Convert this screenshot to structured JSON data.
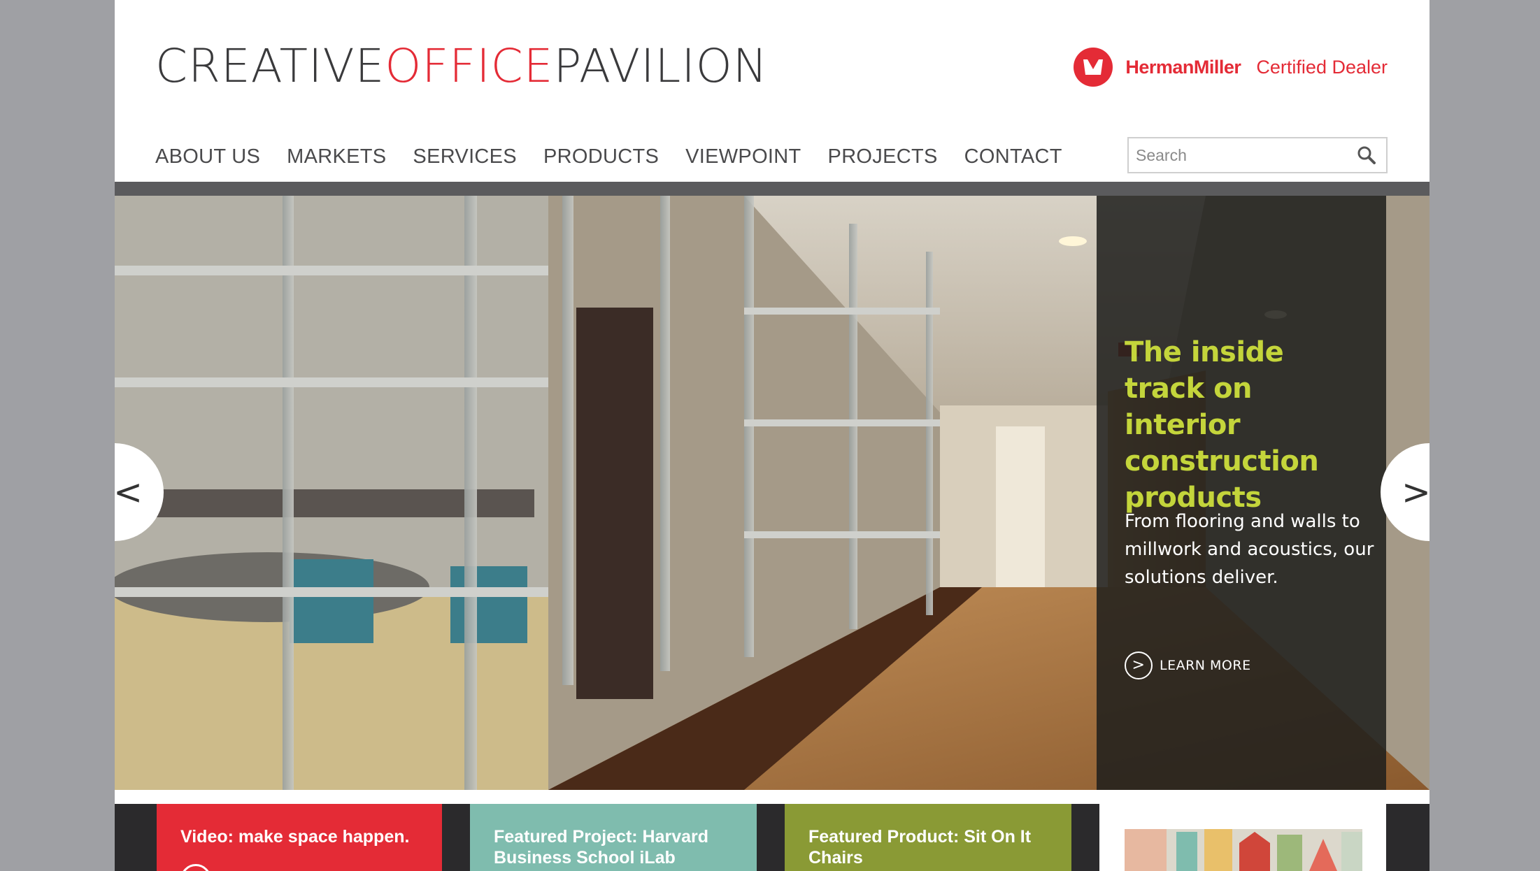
{
  "header": {
    "logo": {
      "part1": "CREATIVE",
      "part2": "OFFICE",
      "part3": "PAVILION"
    },
    "dealer": {
      "brand": "HermanMiller",
      "certified": "Certified Dealer"
    }
  },
  "nav": {
    "items": [
      {
        "label": "ABOUT US"
      },
      {
        "label": "MARKETS"
      },
      {
        "label": "SERVICES"
      },
      {
        "label": "PRODUCTS"
      },
      {
        "label": "VIEWPOINT"
      },
      {
        "label": "PROJECTS"
      },
      {
        "label": "CONTACT"
      }
    ]
  },
  "search": {
    "placeholder": "Search",
    "value": ""
  },
  "hero": {
    "headline": "The inside track on interior construction products",
    "subtext": "From flooring and walls to millwork and acoustics, our solutions deliver.",
    "cta": "LEARN MORE",
    "cta_icon": ">",
    "prev_icon": "<",
    "next_icon": ">"
  },
  "tiles": [
    {
      "label": "Video: make space happen."
    },
    {
      "label": "Featured Project: Harvard Business School iLab"
    },
    {
      "label": "Featured Product: Sit On It Chairs"
    }
  ],
  "colors": {
    "brand_red": "#e42b36",
    "headline_green": "#c4d53b",
    "tile_teal": "#7fbcae",
    "tile_olive": "#8a9a35"
  }
}
